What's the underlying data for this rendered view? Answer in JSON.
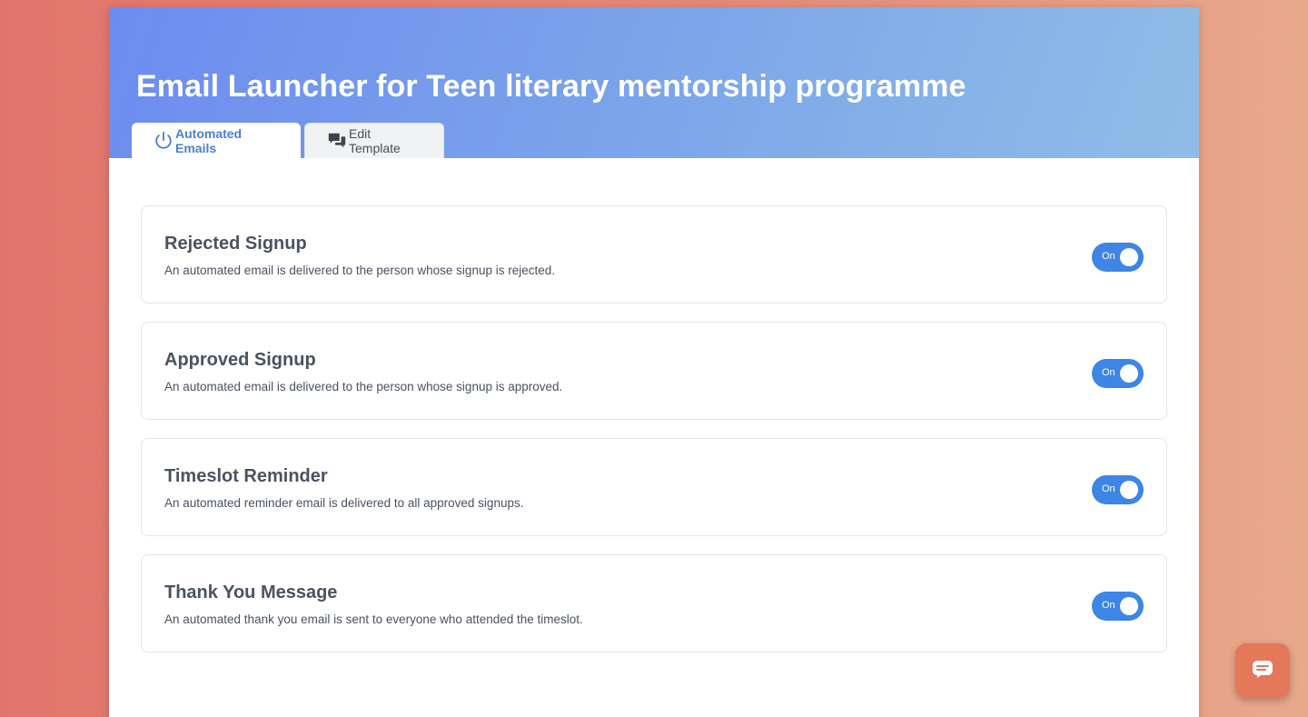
{
  "header": {
    "title": "Email Launcher for Teen literary mentorship programme"
  },
  "tabs": [
    {
      "label": "Automated Emails",
      "icon": "power-icon",
      "active": true
    },
    {
      "label": "Edit Template",
      "icon": "chat-bubbles-icon",
      "active": false
    }
  ],
  "cards": [
    {
      "title": "Rejected Signup",
      "description": "An automated email is delivered to the person whose signup is rejected.",
      "toggle": "On"
    },
    {
      "title": "Approved Signup",
      "description": "An automated email is delivered to the person whose signup is approved.",
      "toggle": "On"
    },
    {
      "title": "Timeslot Reminder",
      "description": "An automated reminder email is delivered to all approved signups.",
      "toggle": "On"
    },
    {
      "title": "Thank You Message",
      "description": "An automated thank you email is sent to everyone who attended the timeslot.",
      "toggle": "On"
    }
  ],
  "chat": {
    "icon": "chat-icon"
  },
  "colors": {
    "accent": "#3d86e6",
    "chat": "#e5775a"
  }
}
